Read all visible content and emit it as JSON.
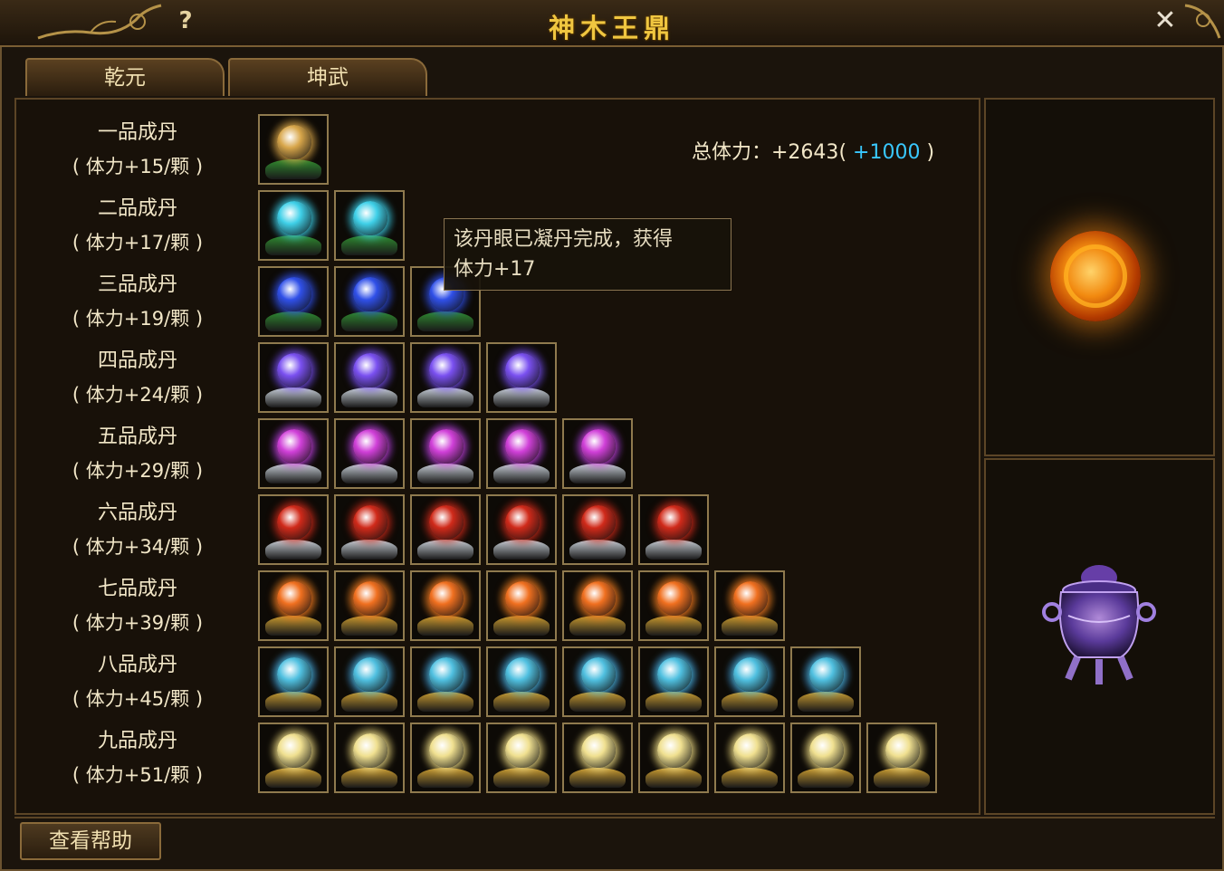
{
  "window": {
    "title": "神木王鼎",
    "help_icon": "?",
    "close_icon": "✕"
  },
  "tabs": [
    {
      "label": "乾元"
    },
    {
      "label": "坤武"
    }
  ],
  "grades": [
    {
      "name": "一品成丹",
      "bonus": "( 体力+15/颗 )",
      "count": 1,
      "orb": "#d8a64a",
      "glow": "#c08a30",
      "base": "#2f8a2f"
    },
    {
      "name": "二品成丹",
      "bonus": "( 体力+17/颗 )",
      "count": 2,
      "orb": "#3fd0e8",
      "glow": "#1aa0c0",
      "base": "#2f8a2f"
    },
    {
      "name": "三品成丹",
      "bonus": "( 体力+19/颗 )",
      "count": 3,
      "orb": "#3050e8",
      "glow": "#1a2fa0",
      "base": "#2f8a2f"
    },
    {
      "name": "四品成丹",
      "bonus": "( 体力+24/颗 )",
      "count": 4,
      "orb": "#7a50f0",
      "glow": "#3a2aa8",
      "base": "#c8d0d8"
    },
    {
      "name": "五品成丹",
      "bonus": "( 体力+29/颗 )",
      "count": 5,
      "orb": "#d040d8",
      "glow": "#2a30c8",
      "base": "#c8d0d8"
    },
    {
      "name": "六品成丹",
      "bonus": "( 体力+34/颗 )",
      "count": 6,
      "orb": "#d02a1a",
      "glow": "#7a1a10",
      "base": "#c8d0d8"
    },
    {
      "name": "七品成丹",
      "bonus": "( 体力+39/颗 )",
      "count": 7,
      "orb": "#f07020",
      "glow": "#f0b020",
      "base": "#c89a30"
    },
    {
      "name": "八品成丹",
      "bonus": "( 体力+45/颗 )",
      "count": 8,
      "orb": "#50c0e0",
      "glow": "#1a50e0",
      "base": "#c89a30"
    },
    {
      "name": "九品成丹",
      "bonus": "( 体力+51/颗 )",
      "count": 9,
      "orb": "#f0e090",
      "glow": "#c0a030",
      "base": "#c89a30"
    }
  ],
  "total": {
    "label": "总体力：+2643",
    "open": "(",
    "bonus": " +1000",
    "close": ")"
  },
  "tooltip": {
    "line1": "该丹眼已凝丹完成，获得",
    "line2": "体力+17"
  },
  "side": {
    "top_icon": "fire-orb-icon",
    "bottom_icon": "cauldron-icon"
  },
  "help_button": "查看帮助"
}
